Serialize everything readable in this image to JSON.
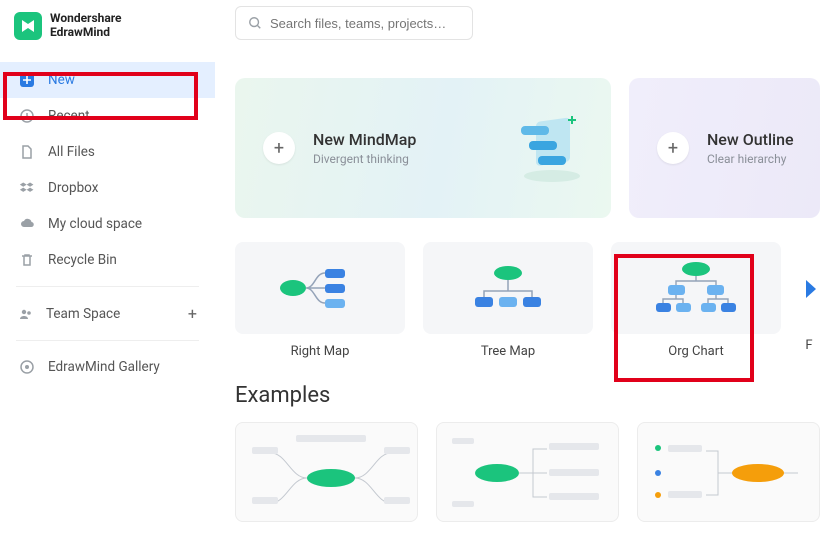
{
  "brand": {
    "line1": "Wondershare",
    "line2": "EdrawMind"
  },
  "search": {
    "placeholder": "Search files, teams, projects…"
  },
  "sidebar": {
    "items": [
      {
        "label": "New",
        "icon": "plus-square-icon",
        "active": true
      },
      {
        "label": "Recent",
        "icon": "clock-icon"
      },
      {
        "label": "All Files",
        "icon": "file-icon"
      },
      {
        "label": "Dropbox",
        "icon": "dropbox-icon"
      },
      {
        "label": "My cloud space",
        "icon": "cloud-icon"
      },
      {
        "label": "Recycle Bin",
        "icon": "trash-icon"
      }
    ],
    "team": {
      "label": "Team Space"
    },
    "gallery": {
      "label": "EdrawMind Gallery"
    }
  },
  "hero": {
    "mindmap": {
      "title": "New MindMap",
      "subtitle": "Divergent thinking"
    },
    "outline": {
      "title": "New Outline",
      "subtitle": "Clear hierarchy"
    }
  },
  "templates": [
    {
      "label": "Right Map"
    },
    {
      "label": "Tree Map"
    },
    {
      "label": "Org Chart"
    },
    {
      "label": "F"
    }
  ],
  "examples": {
    "title": "Examples"
  }
}
